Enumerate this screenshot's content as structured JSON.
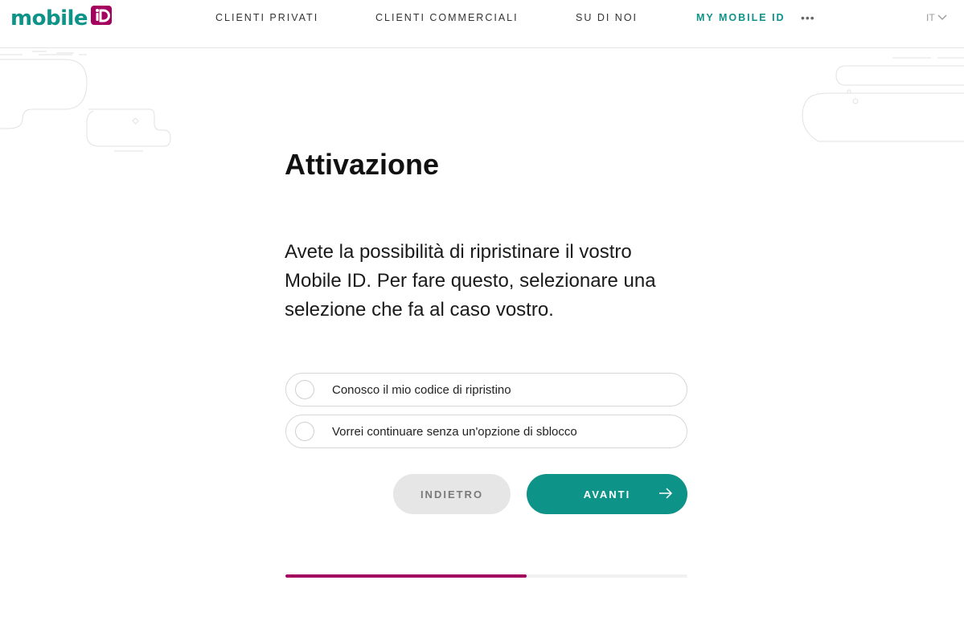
{
  "header": {
    "logo_text": "mobile",
    "nav": [
      {
        "label": "CLIENTI PRIVATI",
        "active": false
      },
      {
        "label": "CLIENTI COMMERCIALI",
        "active": false
      },
      {
        "label": "SU DI NOI",
        "active": false
      },
      {
        "label": "MY MOBILE ID",
        "active": true
      }
    ],
    "more_icon": "•••",
    "language": "IT"
  },
  "main": {
    "title": "Attivazione",
    "description": "Avete la possibilità di ripristinare il vostro Mobile ID. Per fare questo, selezionare una selezione che fa al caso vostro.",
    "options": [
      {
        "label": "Conosco il mio codice di ripristino",
        "selected": false
      },
      {
        "label": "Vorrei continuare senza un'opzione di sblocco",
        "selected": false
      }
    ],
    "back_label": "INDIETRO",
    "next_label": "AVANTI"
  },
  "progress": {
    "fraction": 0.6
  },
  "colors": {
    "brand_teal": "#0e9389",
    "brand_magenta": "#a3005f",
    "back_button_bg": "#e6e6e6"
  },
  "icons": [
    "mobile-id-logo-icon",
    "more-horizontal-icon",
    "chevron-down-icon",
    "arrow-right-icon"
  ]
}
